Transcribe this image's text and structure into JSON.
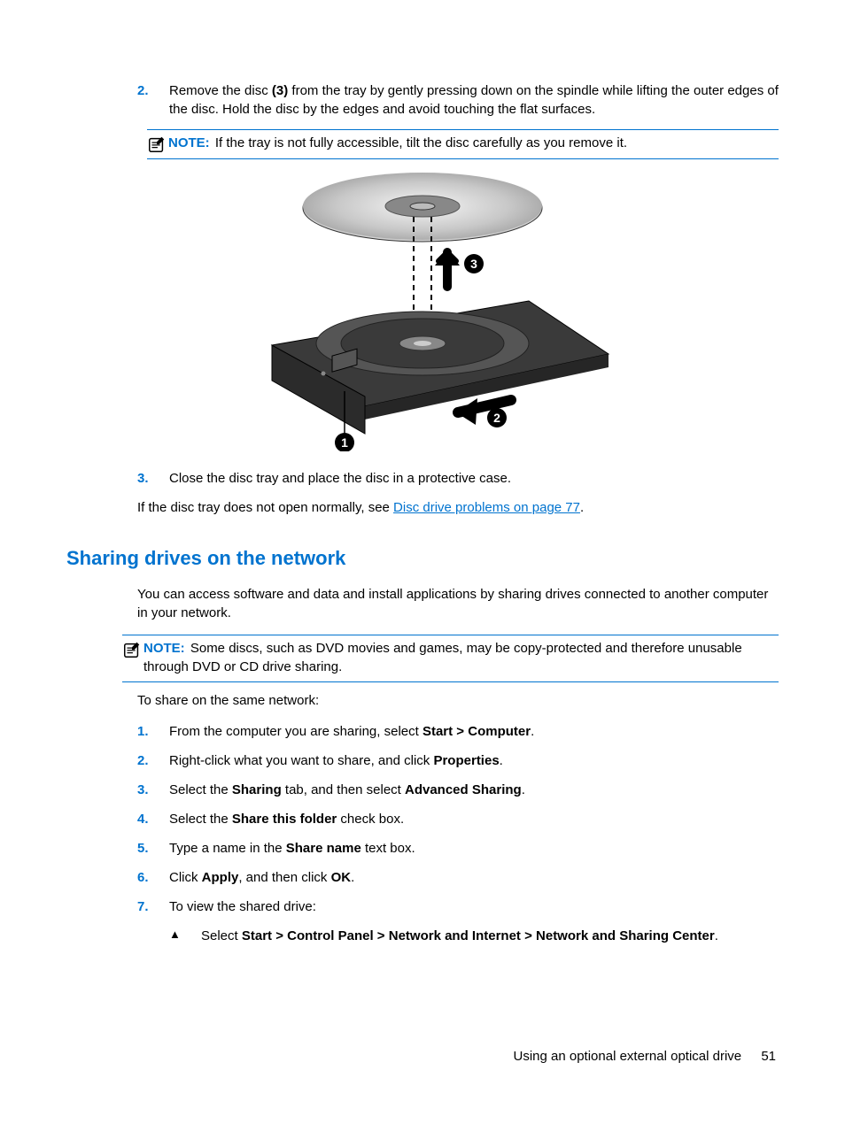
{
  "step2": {
    "num": "2.",
    "pre": "Remove the disc ",
    "bold": "(3)",
    "post": " from the tray by gently pressing down on the spindle while lifting the outer edges of the disc. Hold the disc by the edges and avoid touching the flat surfaces."
  },
  "note1": {
    "label": "NOTE:",
    "text": "If the tray is not fully accessible, tilt the disc carefully as you remove it."
  },
  "callouts": {
    "c1": "1",
    "c2": "2",
    "c3": "3"
  },
  "step3": {
    "num": "3.",
    "text": "Close the disc tray and place the disc in a protective case."
  },
  "para_link": {
    "pre": "If the disc tray does not open normally, see ",
    "link": "Disc drive problems on page 77",
    "post": "."
  },
  "heading": "Sharing drives on the network",
  "intro": "You can access software and data and install applications by sharing drives connected to another computer in your network.",
  "note2": {
    "label": "NOTE:",
    "text": "Some discs, such as DVD movies and games, may be copy-protected and therefore unusable through DVD or CD drive sharing."
  },
  "lead": "To share on the same network:",
  "steps": {
    "s1": {
      "num": "1.",
      "pre": "From the computer you are sharing, select ",
      "b": "Start > Computer",
      "post": "."
    },
    "s2": {
      "num": "2.",
      "pre": "Right-click what you want to share, and click ",
      "b": "Properties",
      "post": "."
    },
    "s3": {
      "num": "3.",
      "pre": "Select the ",
      "b1": "Sharing",
      "mid": " tab, and then select ",
      "b2": "Advanced Sharing",
      "post": "."
    },
    "s4": {
      "num": "4.",
      "pre": "Select the ",
      "b": "Share this folder",
      "post": " check box."
    },
    "s5": {
      "num": "5.",
      "pre": "Type a name in the ",
      "b": "Share name",
      "post": " text box."
    },
    "s6": {
      "num": "6.",
      "pre": "Click ",
      "b1": "Apply",
      "mid": ", and then click ",
      "b2": "OK",
      "post": "."
    },
    "s7": {
      "num": "7.",
      "text": "To view the shared drive:"
    }
  },
  "sub": {
    "tri": "▲",
    "pre": "Select ",
    "b": "Start > Control Panel > Network and Internet > Network and Sharing Center",
    "post": "."
  },
  "footer": {
    "title": "Using an optional external optical drive",
    "page": "51"
  }
}
